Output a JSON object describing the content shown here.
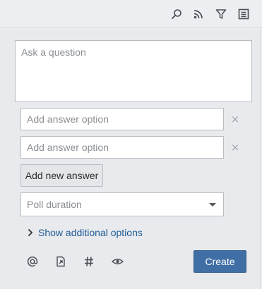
{
  "toolbar": {
    "icons": [
      "search-icon",
      "rss-feed-icon",
      "filter-icon",
      "list-view-icon"
    ]
  },
  "poll": {
    "question_placeholder": "Ask a question",
    "answers": [
      {
        "placeholder": "Add answer option",
        "remove_label": "×"
      },
      {
        "placeholder": "Add answer option",
        "remove_label": "×"
      }
    ],
    "add_answer_label": "Add new answer",
    "duration_label": "Poll duration",
    "more_options_label": "Show additional options",
    "create_label": "Create"
  },
  "footer_tools": [
    "mention-icon",
    "attach-file-icon",
    "hashtag-icon",
    "visibility-icon"
  ],
  "colors": {
    "accent": "#3f6fa4",
    "link": "#1f5b94",
    "background": "#e8eaed"
  }
}
